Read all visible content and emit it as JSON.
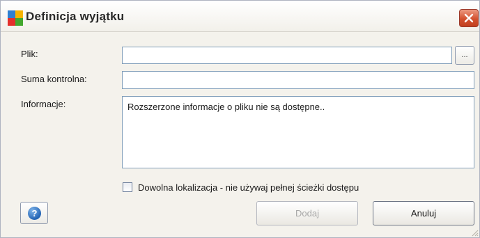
{
  "window": {
    "title": "Definicja wyjątku"
  },
  "icons": {
    "app": "avg-app-icon",
    "close": "close-icon",
    "help": "help-icon",
    "grip": "resize-grip-icon"
  },
  "form": {
    "file_label": "Plik:",
    "file_value": "",
    "browse_label": "...",
    "checksum_label": "Suma kontrolna:",
    "checksum_value": "",
    "info_label": "Informacje:",
    "info_text": "Rozszerzone informacje o pliku nie są dostępne..",
    "any_location_label": "Dowolna lokalizacja - nie używaj pełnej ścieżki dostępu",
    "any_location_checked": false
  },
  "buttons": {
    "help_glyph": "?",
    "add_label": "Dodaj",
    "add_enabled": false,
    "cancel_label": "Anuluj"
  },
  "colors": {
    "close_red": "#d3512f",
    "help_blue": "#2364b4",
    "field_border": "#7f9db9"
  }
}
